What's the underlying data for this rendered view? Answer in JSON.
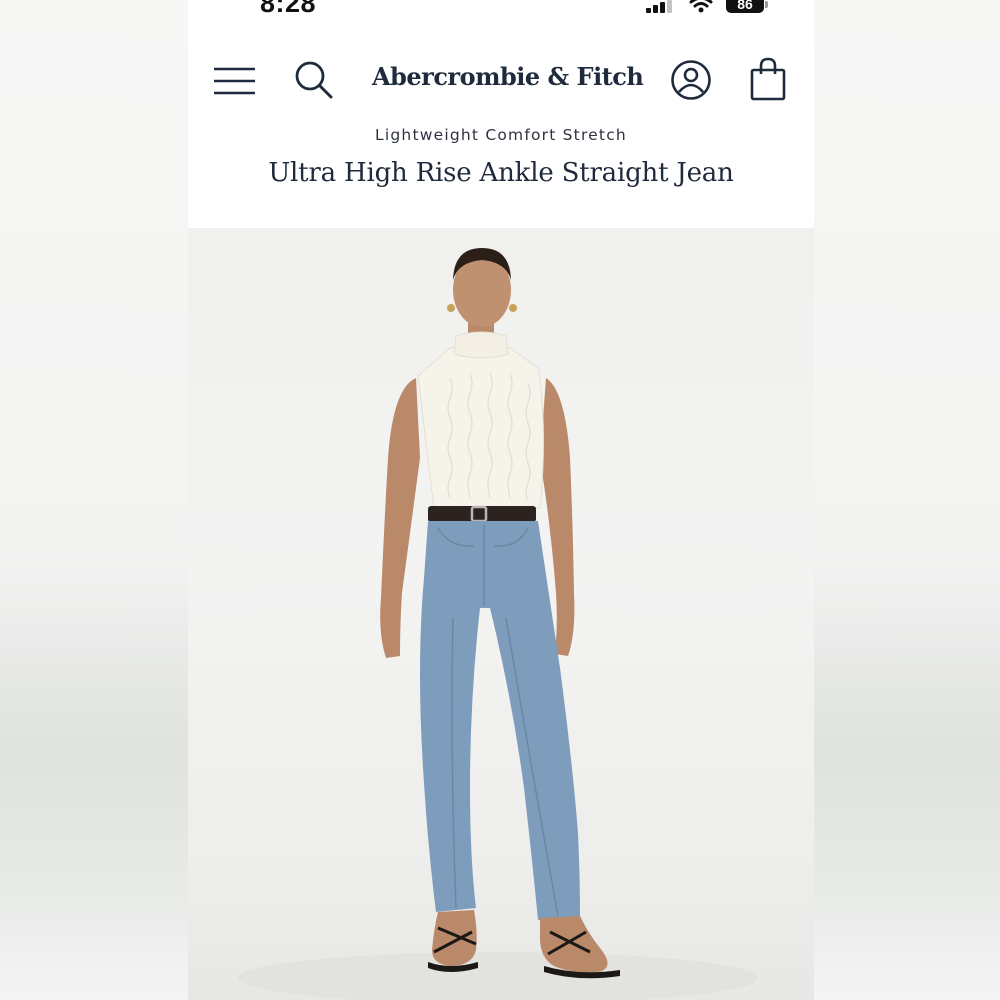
{
  "status_bar": {
    "time": "8:28",
    "battery_level": "86"
  },
  "header": {
    "menu_icon": "hamburger-menu-icon",
    "search_icon": "search-icon",
    "brand": "Abercrombie & Fitch",
    "account_icon": "account-icon",
    "bag_icon": "shopping-bag-icon"
  },
  "product": {
    "subtitle": "Lightweight Comfort Stretch",
    "title": "Ultra High Rise Ankle Straight Jean",
    "image_alt_hint": "model wearing jeans"
  },
  "colors": {
    "navy": "#1f2b3d",
    "denim": "#7e9dbd",
    "top": "#f6f3ea",
    "background": "#f0f0ee"
  }
}
